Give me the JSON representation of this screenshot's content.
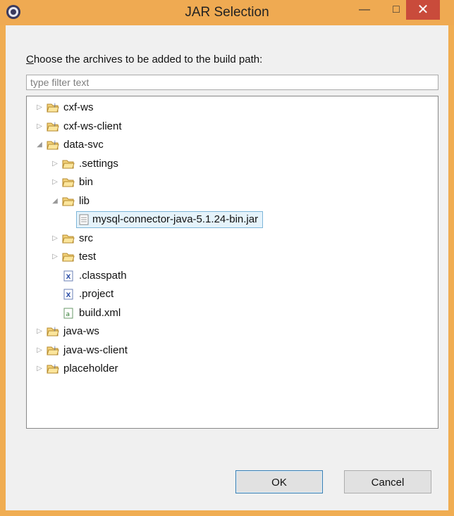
{
  "window": {
    "title": "JAR Selection",
    "minimize_label": "—",
    "maximize_label": "□",
    "close_label": "✕"
  },
  "prompt": {
    "text_prefix": "C",
    "text_rest": "hoose the archives to be added to the build path:"
  },
  "filter": {
    "placeholder": "type filter text",
    "value": ""
  },
  "tree": {
    "items": [
      {
        "label": "cxf-ws",
        "type": "project",
        "state": "collapsed",
        "level": 0
      },
      {
        "label": "cxf-ws-client",
        "type": "project",
        "state": "collapsed",
        "level": 0
      },
      {
        "label": "data-svc",
        "type": "project",
        "state": "expanded",
        "level": 0
      },
      {
        "label": ".settings",
        "type": "folder",
        "state": "collapsed",
        "level": 1
      },
      {
        "label": "bin",
        "type": "folder",
        "state": "collapsed",
        "level": 1
      },
      {
        "label": "lib",
        "type": "folder",
        "state": "expanded",
        "level": 1
      },
      {
        "label": "mysql-connector-java-5.1.24-bin.jar",
        "type": "jar",
        "state": "leaf",
        "level": 2,
        "selected": true
      },
      {
        "label": "src",
        "type": "folder",
        "state": "collapsed",
        "level": 1
      },
      {
        "label": "test",
        "type": "folder",
        "state": "collapsed",
        "level": 1
      },
      {
        "label": ".classpath",
        "type": "xfile",
        "state": "leaf",
        "level": 1
      },
      {
        "label": ".project",
        "type": "xfile",
        "state": "leaf",
        "level": 1
      },
      {
        "label": "build.xml",
        "type": "antfile",
        "state": "leaf",
        "level": 1
      },
      {
        "label": "java-ws",
        "type": "project",
        "state": "collapsed",
        "level": 0
      },
      {
        "label": "java-ws-client",
        "type": "project",
        "state": "collapsed",
        "level": 0
      },
      {
        "label": "placeholder",
        "type": "project",
        "state": "collapsed",
        "level": 0
      }
    ]
  },
  "buttons": {
    "ok_label": "OK",
    "cancel_label": "Cancel"
  },
  "colors": {
    "titlebar": "#efaa52",
    "close": "#c94b3b",
    "selection_bg": "#e5f3fb",
    "selection_border": "#7db6d9"
  }
}
